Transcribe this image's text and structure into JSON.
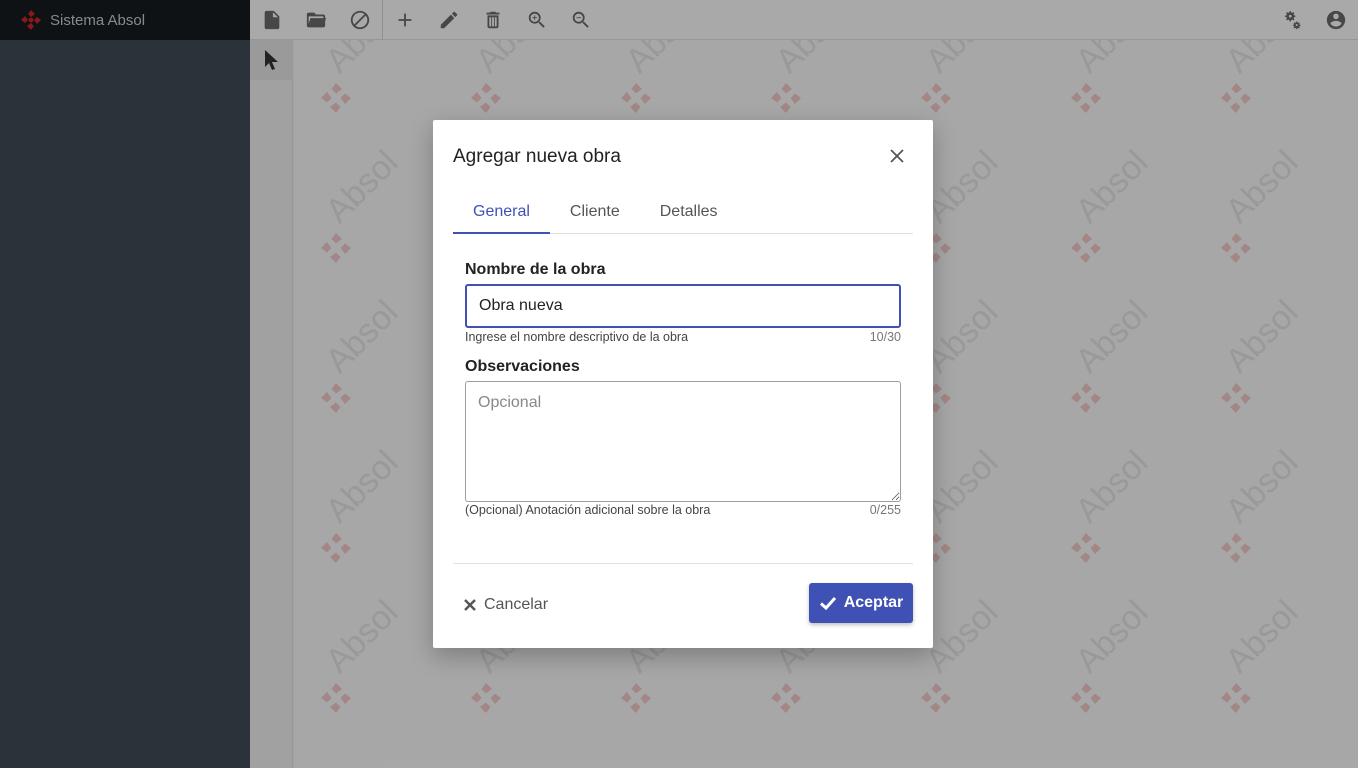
{
  "app": {
    "title": "Sistema Absol"
  },
  "toolbar": {
    "left_icons": [
      "new-file-icon",
      "open-folder-icon",
      "cancel-icon",
      "add-icon",
      "edit-pencil-icon",
      "delete-trash-icon",
      "zoom-in-icon",
      "zoom-out-icon"
    ],
    "right_icons": [
      "settings-gears-icon",
      "user-account-icon"
    ]
  },
  "tools": {
    "selected": "select-pointer-icon"
  },
  "watermark": {
    "text": "Absol"
  },
  "modal": {
    "title": "Agregar nueva obra",
    "tabs": [
      {
        "label": "General",
        "active": true
      },
      {
        "label": "Cliente",
        "active": false
      },
      {
        "label": "Detalles",
        "active": false
      }
    ],
    "name_field": {
      "label": "Nombre de la obra",
      "value": "Obra nueva",
      "hint": "Ingrese el nombre descriptivo de la obra",
      "counter": "10/30"
    },
    "notes_field": {
      "label": "Observaciones",
      "placeholder": "Opcional",
      "value": "",
      "hint": "(Opcional) Anotación adicional sobre la obra",
      "counter": "0/255"
    },
    "cancel_label": "Cancelar",
    "accept_label": "Aceptar"
  },
  "colors": {
    "accent": "#3f51b5",
    "brand_red": "#d32f2f",
    "sidebar": "#414b55"
  }
}
